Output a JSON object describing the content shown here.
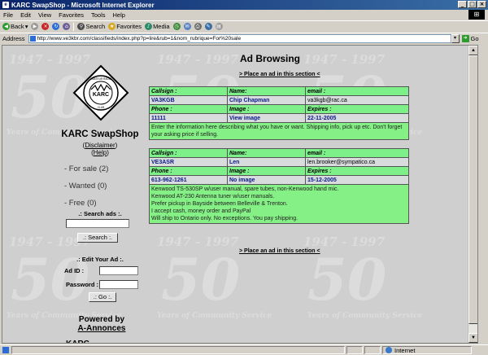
{
  "window": {
    "title": "KARC SwapShop - Microsoft Internet Explorer",
    "minimize_glyph": "_",
    "maximize_glyph": "□",
    "close_glyph": "×"
  },
  "menu": [
    "File",
    "Edit",
    "View",
    "Favorites",
    "Tools",
    "Help"
  ],
  "toolbar": {
    "back_label": "Back",
    "search_label": "Search",
    "favorites_label": "Favorites",
    "media_label": "Media"
  },
  "address": {
    "label": "Address",
    "url": "http://www.ve3kbr.com/classifieds/index.php?p=lire&rub=1&nom_rubrique=For%20sale",
    "go_label": "Go"
  },
  "sidebar": {
    "site_title": "KARC SwapShop",
    "disclaimer": "Disclaimer",
    "help": "Help",
    "categories": [
      {
        "label": "- For sale (2)"
      },
      {
        "label": "- Wanted (0)"
      },
      {
        "label": "- Free (0)"
      }
    ],
    "search_heading": ".: Search ads :.",
    "search_button": ".: Search :.",
    "edit_heading": ".: Edit Your Ad :.",
    "ad_id_label": "Ad ID :",
    "password_label": "Password :",
    "go_button": ".: Go :.",
    "powered_by": "Powered by",
    "powered_link": "A-Annonces",
    "cut_text": "KARC"
  },
  "logo": {
    "center_text": "KARC",
    "ring_top": "AMATEUR RADIO",
    "ring_bottom": "CLUB"
  },
  "watermark": {
    "years": "1947 - 1997",
    "big": "50",
    "caption": "Years of Community Service"
  },
  "main": {
    "title": "Ad Browsing",
    "place_ad": "> Place an ad in this section <"
  },
  "ads": [
    {
      "labels": {
        "callsign": "Callsign :",
        "name": "Name:",
        "email": "email :",
        "phone": "Phone :",
        "image": "Image :",
        "expires": "Expires :"
      },
      "callsign": "VA3KGB",
      "name": "Chip Chapman",
      "email": "va3kgb@rac.ca",
      "phone": "11111",
      "image": "View image",
      "expires": "22-11-2005",
      "description": [
        "Enter the information here describing what you have or want. Shipping info, pick up etc. Don't forget your asking price if selling."
      ]
    },
    {
      "labels": {
        "callsign": "Callsign :",
        "name": "Name:",
        "email": "email :",
        "phone": "Phone :",
        "image": "Image :",
        "expires": "Expires :"
      },
      "callsign": "VE3ASR",
      "name": "Len",
      "email": "len.brooker@sympatico.ca",
      "phone": "613-962-1261",
      "image": "No image",
      "expires": "15-12-2005",
      "description": [
        "Kenwood TS-530SP w/user manual, spare tubes, non-Kenwood hand mic.",
        "Kenwood AT-230 Antenna tuner w/user manuals.",
        "Prefer pickup in Bayside between Belleville & Trenton.",
        "I accept cash, money order and PayPal",
        "Will ship to Ontario only. No exceptions. You pay shipping."
      ]
    }
  ],
  "status": {
    "zone": "Internet"
  }
}
